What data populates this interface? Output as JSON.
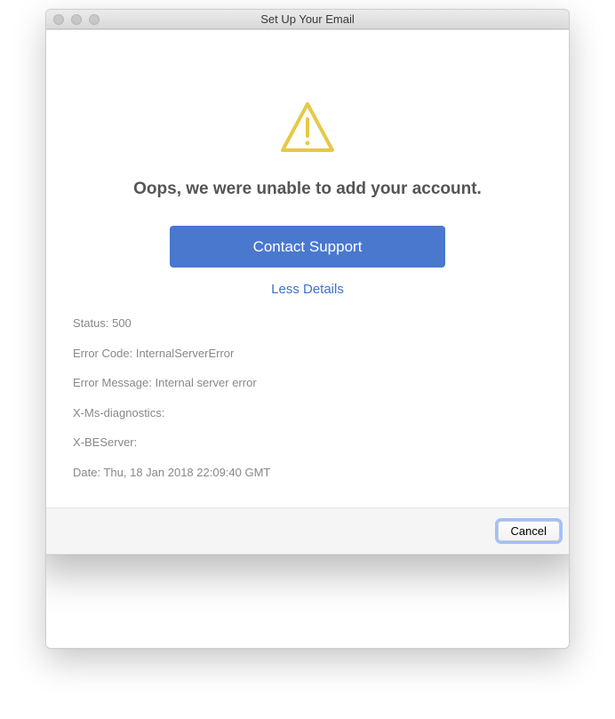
{
  "window": {
    "title": "Set Up Your Email"
  },
  "dialog": {
    "heading": "Oops, we were unable to add your account.",
    "primary_button": "Contact Support",
    "less_details": "Less Details",
    "cancel": "Cancel",
    "details": {
      "status_label": "Status:",
      "status_value": "500",
      "error_code_label": "Error Code:",
      "error_code_value": "InternalServerError",
      "error_msg_label": "Error Message:",
      "error_msg_value": "Internal server error",
      "diag_label": "X-Ms-diagnostics:",
      "diag_value": "",
      "beserver_label": "X-BEServer:",
      "beserver_value": "",
      "date_label": "Date:",
      "date_value": "Thu, 18 Jan 2018 22:09:40 GMT"
    }
  }
}
